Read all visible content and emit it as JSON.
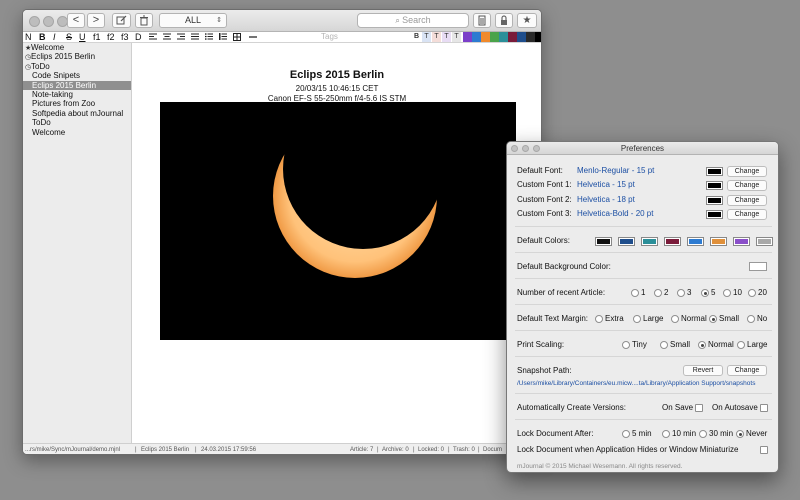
{
  "main_window": {
    "toolbar": {
      "back_label": "<",
      "forward_label": ">",
      "filter_value": "ALL",
      "search_placeholder": "Search"
    },
    "format_bar": {
      "buttons": [
        "N",
        "B",
        "I",
        "S",
        "U",
        "f1",
        "f2",
        "f3",
        "D"
      ],
      "tags_placeholder": "Tags",
      "text_color_buttons": [
        "B",
        "T",
        "T",
        "T",
        "T"
      ],
      "color_swatches": [
        "#7b3fc9",
        "#2d7bd1",
        "#f08a2c",
        "#4aa34a",
        "#2b8f99",
        "#7a1b3a",
        "#1f4e8c",
        "#2a2a2a",
        "#000000"
      ]
    },
    "sidebar": {
      "items": [
        {
          "label": "Welcome",
          "icon": "star-icon",
          "indent": false,
          "selected": false
        },
        {
          "label": "Eclips 2015 Berlin",
          "icon": "clock-icon",
          "indent": false,
          "selected": false
        },
        {
          "label": "ToDo",
          "icon": "clock-icon",
          "indent": false,
          "selected": false
        },
        {
          "label": "Code Snipets",
          "icon": "",
          "indent": true,
          "selected": false
        },
        {
          "label": "Eclips 2015 Berlin",
          "icon": "",
          "indent": true,
          "selected": true
        },
        {
          "label": "Note-taking",
          "icon": "",
          "indent": true,
          "selected": false
        },
        {
          "label": "Pictures from Zoo",
          "icon": "",
          "indent": true,
          "selected": false
        },
        {
          "label": "Softpedia about mJournal",
          "icon": "",
          "indent": true,
          "selected": false
        },
        {
          "label": "ToDo",
          "icon": "",
          "indent": true,
          "selected": false
        },
        {
          "label": "Welcome",
          "icon": "",
          "indent": true,
          "selected": false
        }
      ]
    },
    "document": {
      "title": "Eclips 2015 Berlin",
      "timestamp": "20/03/15 10:46:15 CET",
      "lens": "Canon EF-S 55-250mm f/4-5.6 IS STM"
    },
    "status": {
      "path": "...rs/mike/Sync/mJournal/demo.mjnl",
      "doc_name": "Eclips 2015 Berlin",
      "date": "24.03.2015 17:59:56",
      "article": "Article: 7",
      "archive": "Archive: 0",
      "locked": "Locked: 0",
      "trash": "Trash: 0",
      "docum": "Docum"
    }
  },
  "preferences": {
    "title": "Preferences",
    "fonts": [
      {
        "label": "Default Font:",
        "value": "Menlo-Regular - 15 pt",
        "button": "Change"
      },
      {
        "label": "Custom Font 1:",
        "value": "Helvetica - 15 pt",
        "button": "Change"
      },
      {
        "label": "Custom Font 2:",
        "value": "Helvetica - 18 pt",
        "button": "Change"
      },
      {
        "label": "Custom Font 3:",
        "value": "Helvetica-Bold - 20 pt",
        "button": "Change"
      }
    ],
    "default_colors_label": "Default Colors:",
    "default_colors": [
      "#111111",
      "#1f4e8c",
      "#2b8f99",
      "#7a1b3a",
      "#2d7bd1",
      "#e0903a",
      "#8a4fc9",
      "#a8a8a8"
    ],
    "bg_color_label": "Default Background Color:",
    "recent_label": "Number of recent Article:",
    "recent_options": [
      "1",
      "2",
      "3",
      "5",
      "10",
      "20"
    ],
    "recent_selected": "5",
    "margin_label": "Default Text Margin:",
    "margin_options": [
      "Extra",
      "Large",
      "Normal",
      "Small",
      "No"
    ],
    "margin_selected": "Small",
    "scaling_label": "Print Scaling:",
    "scaling_options": [
      "Tiny",
      "Small",
      "Normal",
      "Large"
    ],
    "scaling_selected": "Normal",
    "snapshot_label": "Snapshot Path:",
    "revert_label": "Revert",
    "change_label": "Change",
    "snapshot_path": "/Users/mike/Library/Containers/eu.micw....ta/Library/Application Support/snapshots",
    "versions_label": "Automatically Create Versions:",
    "on_save_label": "On Save",
    "on_autosave_label": "On Autosave",
    "lock_label": "Lock Document After:",
    "lock_options": [
      "5 min",
      "10 min",
      "30 min",
      "Never"
    ],
    "lock_selected": "Never",
    "lock_hide_label": "Lock Document when Application Hides or Window Miniaturize",
    "copyright": "mJournal © 2015 Michael Wesemann. All rights reserved."
  }
}
